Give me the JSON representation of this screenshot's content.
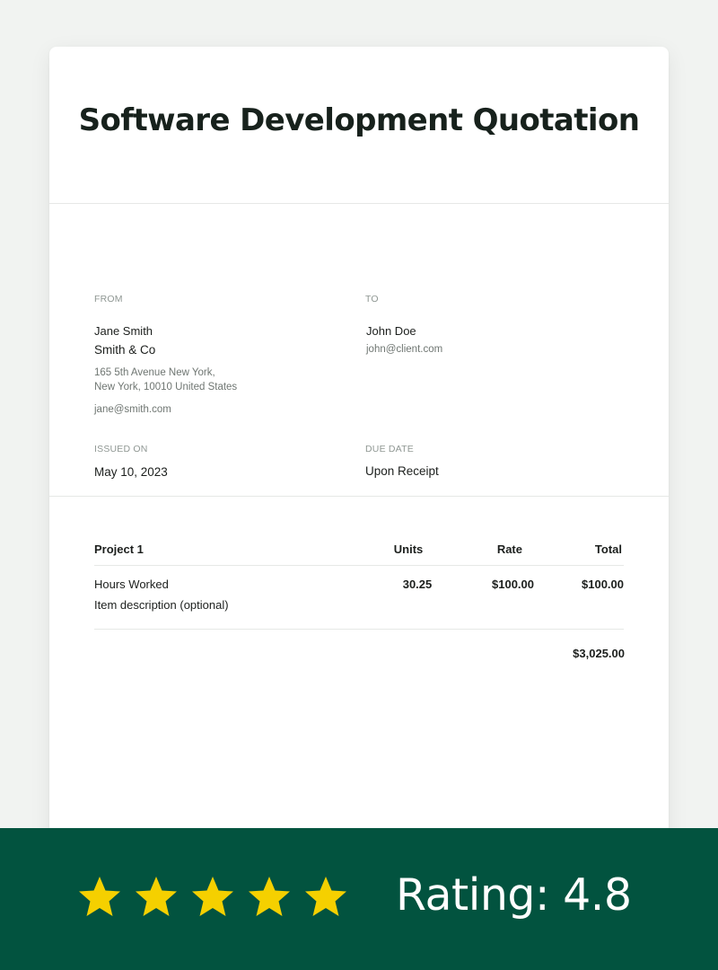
{
  "document": {
    "title": "Software Development Quotation"
  },
  "from": {
    "label": "FROM",
    "name": "Jane Smith",
    "company": "Smith & Co",
    "address_line1": "165 5th Avenue New York,",
    "address_line2": "New York, 10010 United States",
    "email": "jane@smith.com"
  },
  "to": {
    "label": "TO",
    "name": "John Doe",
    "email": "john@client.com"
  },
  "issued": {
    "label": "ISSUED ON",
    "value": "May 10, 2023"
  },
  "due": {
    "label": "DUE DATE",
    "value": "Upon Receipt"
  },
  "table": {
    "headers": {
      "project": "Project 1",
      "units": "Units",
      "rate": "Rate",
      "total": "Total"
    },
    "rows": [
      {
        "item": "Hours Worked",
        "description": "Item description (optional)",
        "units": "30.25",
        "rate": "$100.00",
        "total": "$100.00"
      }
    ],
    "grand_total": "$3,025.00"
  },
  "rating": {
    "stars": 5,
    "text": "Rating: 4.8",
    "star_color": "#f5d000",
    "bar_color": "#02533f"
  }
}
